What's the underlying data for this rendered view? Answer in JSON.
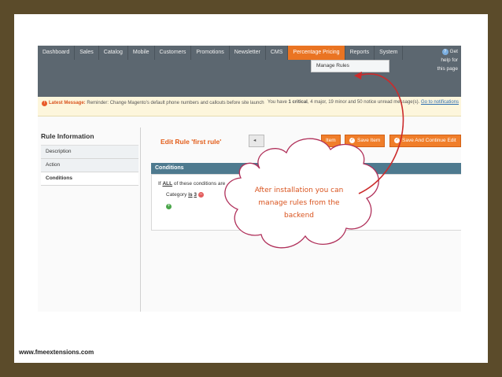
{
  "nav": {
    "items": [
      "Dashboard",
      "Sales",
      "Catalog",
      "Mobile",
      "Customers",
      "Promotions",
      "Newsletter",
      "CMS",
      "Percentage Pricing",
      "Reports",
      "System"
    ],
    "active": "Percentage Pricing",
    "dropdown_item": "Manage Rules",
    "help_line1": "Get",
    "help_line2": "help for",
    "help_line3": "this page"
  },
  "message": {
    "latest_label": "Latest Message:",
    "text": "Reminder: Change Magento's default phone numbers and callouts before site launch",
    "counts_prefix": "You have",
    "critical": "1 critical",
    "major": "4 major",
    "minor": "19 minor",
    "notice": "50 notice unread message(s).",
    "link": "Go to notifications"
  },
  "sidebar": {
    "title": "Rule Information",
    "tabs": [
      "Description",
      "Action",
      "Conditions"
    ],
    "active_tab": "Conditions"
  },
  "main": {
    "title": "Edit Rule 'first rule'",
    "buttons": [
      "Item",
      "Save Item",
      "Save And Continue Edit"
    ],
    "conditions_header": "Conditions",
    "cond_prefix": "If",
    "cond_all": "ALL",
    "cond_suffix": "of these conditions are",
    "cat_label": "Category",
    "cat_op": "is",
    "cat_value": "3"
  },
  "callout": {
    "text_line1": "After installation you can",
    "text_line2": "manage rules from the",
    "text_line3": "backend"
  },
  "footer": "www.fmeextensions.com",
  "colors": {
    "border": "#5b4b2a",
    "nav": "#5c6770",
    "accent": "#ea7422",
    "callout_border": "#b0305a"
  }
}
